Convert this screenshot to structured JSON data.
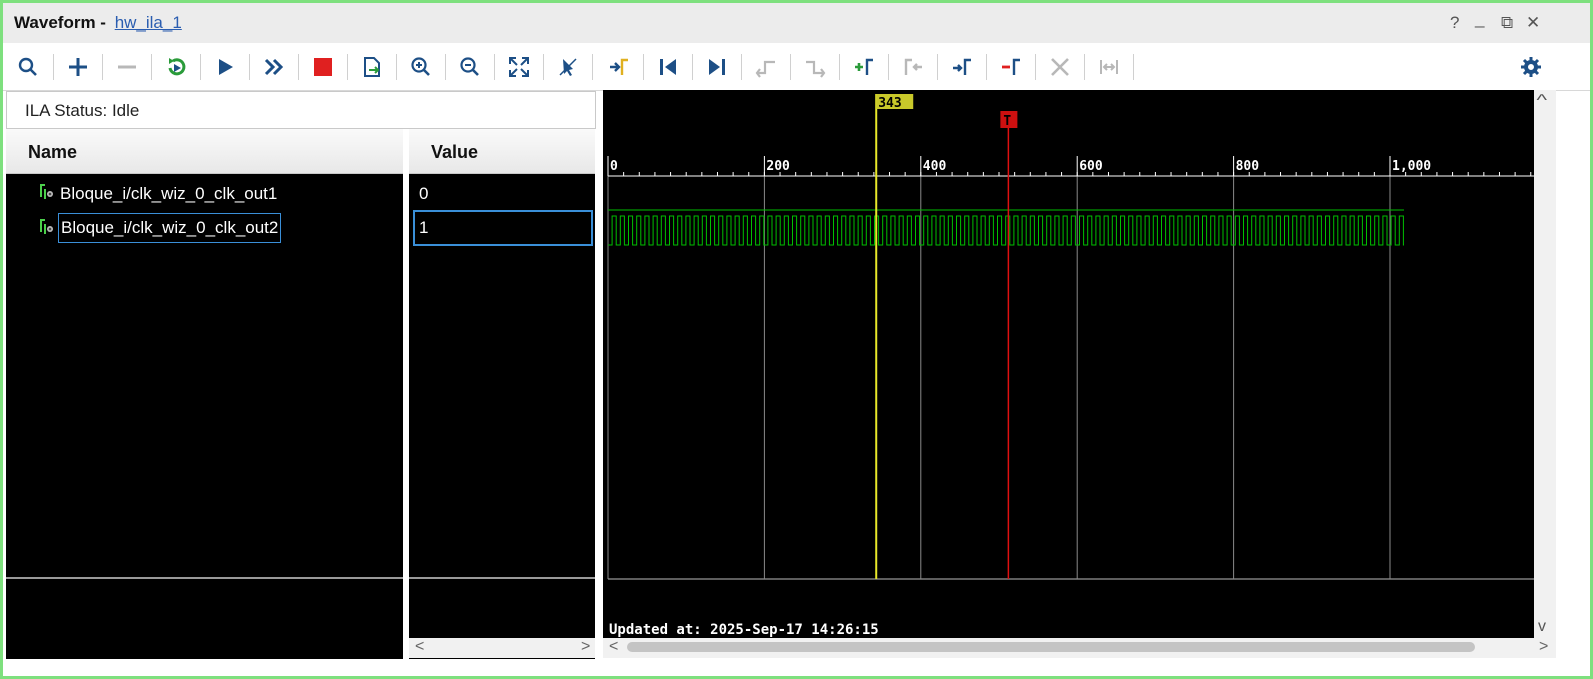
{
  "window": {
    "title": "Waveform -",
    "link": "hw_ila_1",
    "controls": [
      "?",
      "_",
      "⧉",
      "✕"
    ]
  },
  "toolbar": {
    "icons": [
      "search-icon",
      "add-icon",
      "remove-icon",
      "run-trigger-immediate-icon",
      "run-trigger-icon",
      "run-auto-trigger-icon",
      "stop-icon",
      "export-icon",
      "zoom-in-icon",
      "zoom-out-icon",
      "zoom-fit-icon",
      "cursor-icon",
      "goto-cursor-icon",
      "goto-first-icon",
      "goto-last-icon",
      "prev-transition-icon",
      "next-transition-icon",
      "add-marker-icon",
      "prev-marker-icon",
      "next-marker-icon",
      "remove-marker-icon",
      "delete-icon",
      "swap-cursors-icon",
      "settings-icon"
    ]
  },
  "status": {
    "text": "ILA Status:  Idle"
  },
  "columns": {
    "name": "Name",
    "value": "Value"
  },
  "signals": [
    {
      "name": "Bloque_i/clk_wiz_0_clk_out1",
      "value": "0",
      "selected": false
    },
    {
      "name": "Bloque_i/clk_wiz_0_clk_out2",
      "value": "1",
      "selected": true
    }
  ],
  "waveform": {
    "ruler_ticks": [
      "0",
      "200",
      "400",
      "600",
      "800",
      "1,000"
    ],
    "cursor_label": "343",
    "trigger_label": "T",
    "updated_text": "Updated at: 2025-Sep-17 14:26:15",
    "signal_color": "#00c000",
    "cursor_color": "#e8e82a",
    "trigger_color": "#e01010"
  },
  "scroll": {
    "left": "<",
    "right": ">",
    "up": "^",
    "down": "v"
  }
}
